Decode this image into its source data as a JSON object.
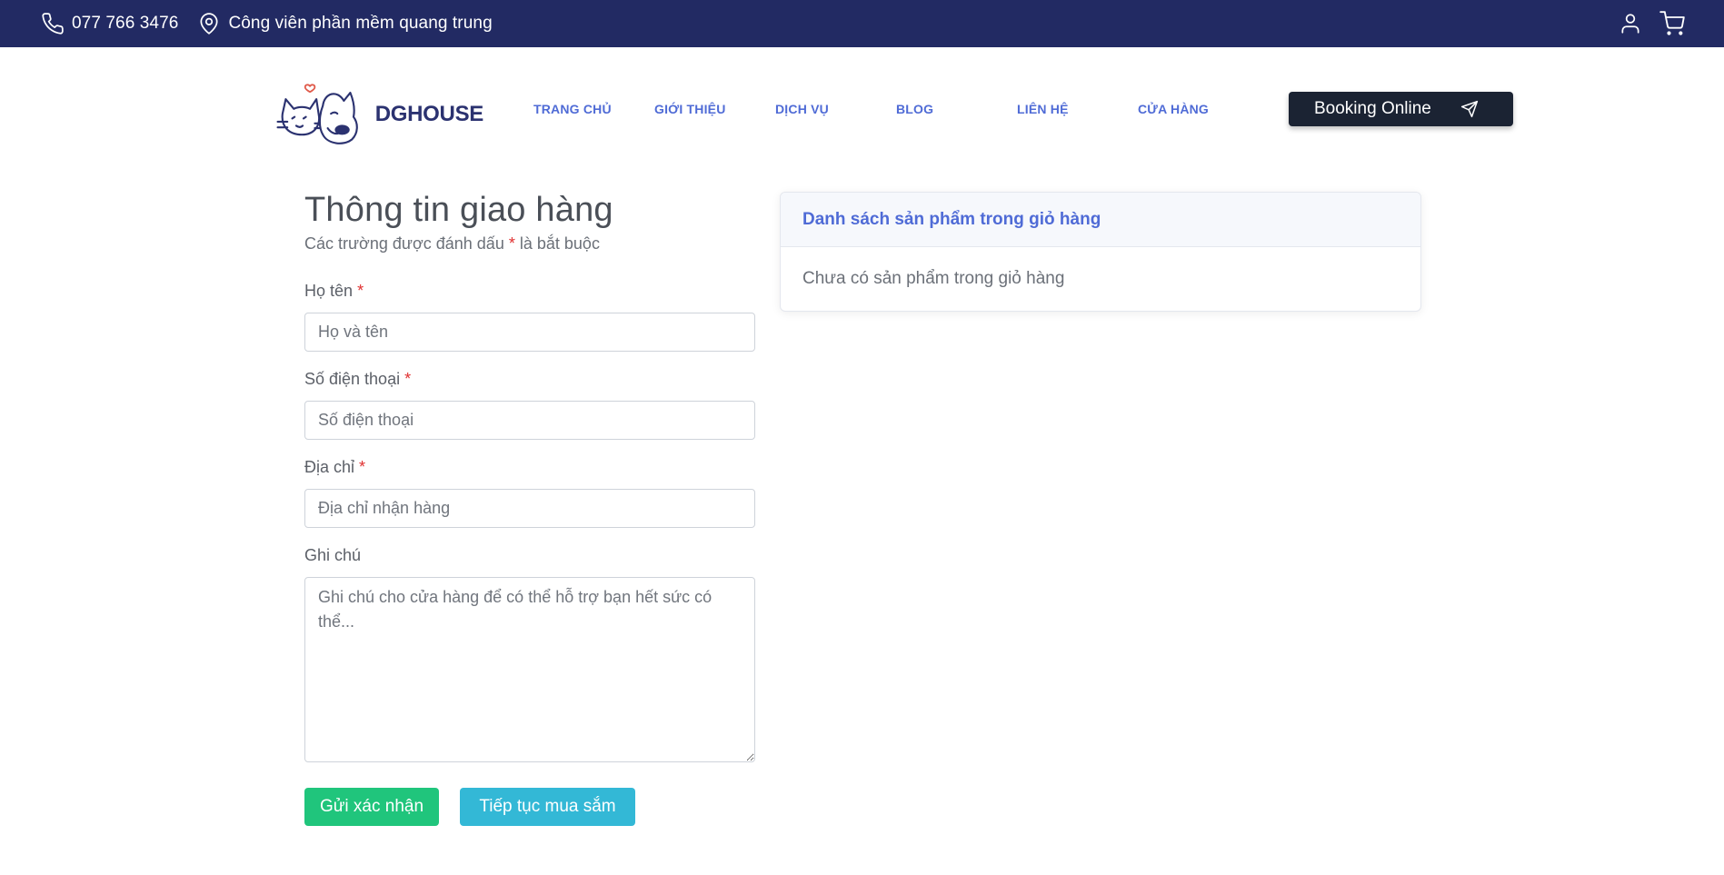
{
  "topbar": {
    "phone": "077 766 3476",
    "address": "Công viên phần mềm quang trung",
    "icons": [
      "phone-icon",
      "location-pin-icon",
      "user-icon",
      "cart-icon"
    ]
  },
  "header": {
    "logo_text": "DGHOUSE",
    "nav": [
      "TRANG CHỦ",
      "GIỚI THIỆU",
      "DỊCH VỤ",
      "BLOG",
      "LIÊN HỆ",
      "CỬA HÀNG"
    ],
    "booking_label": "Booking Online"
  },
  "form": {
    "title": "Thông tin giao hàng",
    "subtitle_before": "Các trường được đánh dấu",
    "required_mark": "*",
    "subtitle_after": "là bắt buộc",
    "fields": [
      {
        "label": "Họ tên",
        "required": true,
        "placeholder": "Họ và tên",
        "value": ""
      },
      {
        "label": "Số điện thoại",
        "required": true,
        "placeholder": "Số điện thoại",
        "value": ""
      },
      {
        "label": "Địa chỉ",
        "required": true,
        "placeholder": "Địa chỉ nhận hàng",
        "value": ""
      }
    ],
    "note": {
      "label": "Ghi chú",
      "placeholder": "Ghi chú cho cửa hàng để có thể hỗ trợ bạn hết sức có thể..."
    },
    "submit_label": "Gửi xác nhận",
    "continue_label": "Tiếp tục mua sắm"
  },
  "cart": {
    "heading": "Danh sách sản phẩm trong giỏ hàng",
    "empty_message": "Chưa có sản phẩm trong giỏ hàng"
  },
  "colors": {
    "topbar_bg": "#222a63",
    "nav_link": "#4f6bd6",
    "booking_bg": "#1b2333",
    "submit_bg": "#20c57c",
    "continue_bg": "#33b8d6",
    "required": "#e03030"
  }
}
